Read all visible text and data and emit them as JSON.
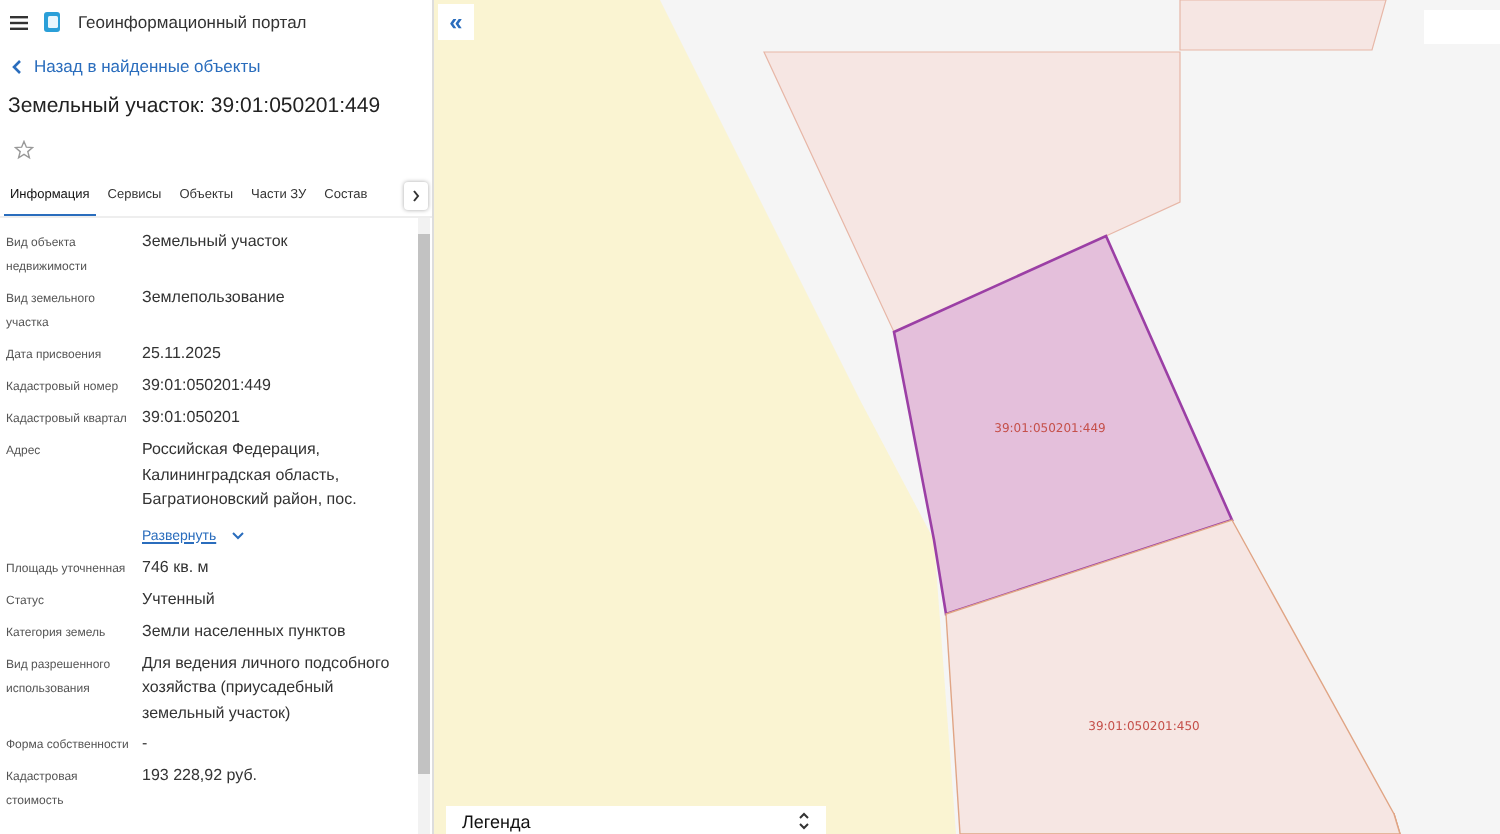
{
  "header": {
    "title": "Геоинформационный портал"
  },
  "back_link": "Назад в найденные объекты",
  "object_title": "Земельный участок: 39:01:050201:449",
  "favorite": {
    "selected": false
  },
  "tabs": [
    {
      "label": "Информация",
      "selected": true
    },
    {
      "label": "Сервисы",
      "selected": false
    },
    {
      "label": "Объекты",
      "selected": false
    },
    {
      "label": "Части ЗУ",
      "selected": false
    },
    {
      "label": "Состав",
      "selected": false
    }
  ],
  "properties": [
    {
      "label": "Вид объекта недвижимости",
      "value": "Земельный участок"
    },
    {
      "label": "Вид земельного участка",
      "value": "Землепользование"
    },
    {
      "label": "Дата присвоения",
      "value": "25.11.2025"
    },
    {
      "label": "Кадастровый номер",
      "value": "39:01:050201:449"
    },
    {
      "label": "Кадастровый квартал",
      "value": "39:01:050201"
    },
    {
      "label": "Адрес",
      "value": "Российская Федерация, Калининградская область, Багратионовский район, пос.",
      "expand_link": "Развернуть"
    },
    {
      "label": "Площадь уточненная",
      "value": "746 кв. м"
    },
    {
      "label": "Статус",
      "value": "Учтенный"
    },
    {
      "label": "Категория земель",
      "value": "Земли населенных пунктов"
    },
    {
      "label": "Вид разрешенного использования",
      "value": "Для ведения личного подсобного хозяйства (приусадебный земельный участок)"
    },
    {
      "label": "Форма собственности",
      "value": "-"
    },
    {
      "label": "Кадастровая стоимость",
      "value": "193 228,92 руб."
    }
  ],
  "map": {
    "collapse_button": "«",
    "parcels": [
      {
        "label": "39:01:050201:449",
        "selected": true
      },
      {
        "label": "39:01:050201:450",
        "selected": false
      }
    ],
    "legend": "Легенда"
  }
}
